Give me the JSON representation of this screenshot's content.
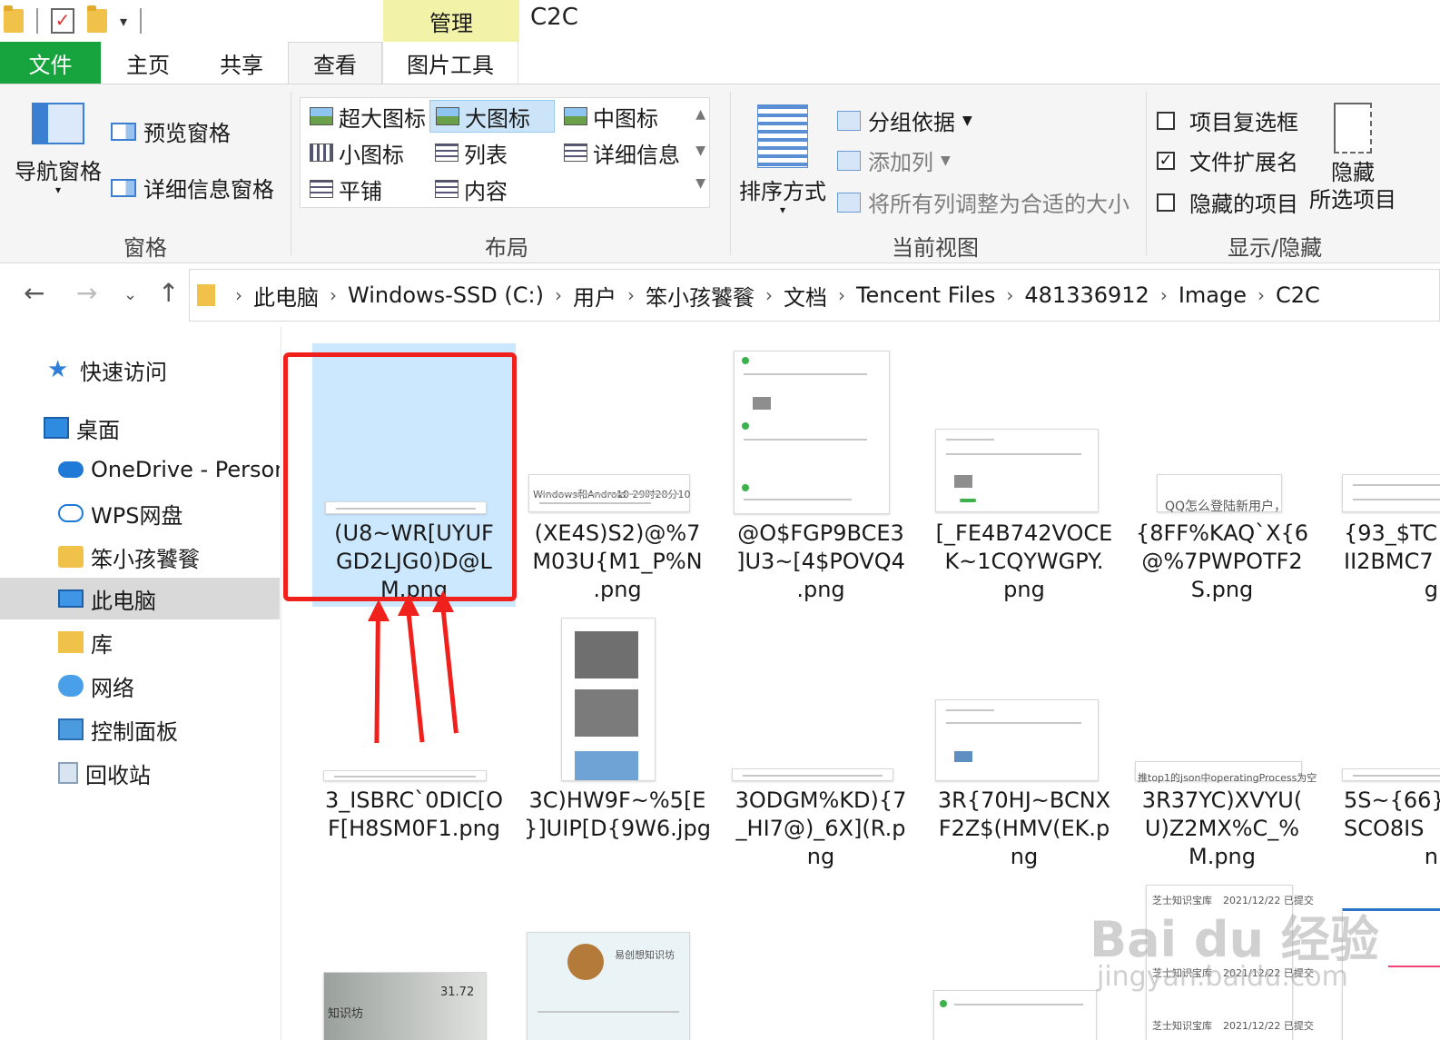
{
  "window": {
    "title": "C2C",
    "context_tab_header": "管理"
  },
  "tabs": [
    {
      "label": "文件"
    },
    {
      "label": "主页"
    },
    {
      "label": "共享"
    },
    {
      "label": "查看"
    },
    {
      "label": "图片工具"
    }
  ],
  "ribbon": {
    "panes": {
      "group_label": "窗格",
      "nav_pane": "导航窗格",
      "preview_pane": "预览窗格",
      "details_pane": "详细信息窗格"
    },
    "layout": {
      "group_label": "布局",
      "items": [
        "超大图标",
        "大图标",
        "中图标",
        "小图标",
        "列表",
        "详细信息",
        "平铺",
        "内容"
      ],
      "selected": "大图标"
    },
    "current_view": {
      "group_label": "当前视图",
      "sort_by": "排序方式",
      "group_by": "分组依据",
      "add_column": "添加列",
      "fit_columns": "将所有列调整为合适的大小"
    },
    "show_hide": {
      "group_label": "显示/隐藏",
      "item_checkboxes": {
        "label": "项目复选框",
        "checked": false
      },
      "file_extensions": {
        "label": "文件扩展名",
        "checked": true
      },
      "hidden_items": {
        "label": "隐藏的项目",
        "checked": false
      },
      "hide_selected_line1": "隐藏",
      "hide_selected_line2": "所选项目"
    }
  },
  "address": {
    "crumbs": [
      "此电脑",
      "Windows-SSD (C:)",
      "用户",
      "笨小孩饕餮",
      "文档",
      "Tencent Files",
      "481336912",
      "Image",
      "C2C"
    ]
  },
  "sidebar": {
    "items": [
      "快速访问",
      "桌面",
      "OneDrive - Person",
      "WPS网盘",
      "笨小孩饕餮",
      "此电脑",
      "库",
      "网络",
      "控制面板",
      "回收站"
    ],
    "selected": "此电脑"
  },
  "files": [
    {
      "name": "(U8~WR[UYUF GD2LJG0)D@L M.png",
      "l1": "(U8~WR[UYUF",
      "l2": "GD2LJG0)D@L",
      "l3": "M.png"
    },
    {
      "name": "(XE4S)S2)@%7 M03U{M1_P%N .png",
      "l1": "(XE4S)S2)@%7",
      "l2": "M03U{M1_P%N",
      "l3": ".png"
    },
    {
      "name": "@O$FGP9BCE3 ]U3~[4$POVQ4 .png",
      "l1": "@O$FGP9BCE3",
      "l2": "]U3~[4$POVQ4",
      "l3": ".png"
    },
    {
      "name": "[_FE4B742VOCE K~1CQYWGPY. png",
      "l1": "[_FE4B742VOCE",
      "l2": "K~1CQYWGPY.",
      "l3": "png"
    },
    {
      "name": "{8FF%KAQ`X{6 @%7PWPOTF2 S.png",
      "l1": "{8FF%KAQ`X{6",
      "l2": "@%7PWPOTF2",
      "l3": "S.png"
    },
    {
      "name": "{93_$TC II2BMC7",
      "l1": "{93_$TC",
      "l2": "II2BMC7",
      "l3": "g"
    },
    {
      "name": "3_ISBRC`0DIC[O F[H8SM0F1.png",
      "l1": "3_ISBRC`0DIC[O",
      "l2": "F[H8SM0F1.png",
      "l3": ""
    },
    {
      "name": "3C)HW9F~%5[E }]UIP[D{9W6.jpg",
      "l1": "3C)HW9F~%5[E",
      "l2": "}]UIP[D{9W6.jpg",
      "l3": ""
    },
    {
      "name": "3ODGM%KD){7 _HI7@)_6X](R.p ng",
      "l1": "3ODGM%KD){7",
      "l2": "_HI7@)_6X](R.p",
      "l3": "ng"
    },
    {
      "name": "3R{70HJ~BCNX F2Z$(HMV(EK.p ng",
      "l1": "3R{70HJ~BCNX",
      "l2": "F2Z$(HMV(EK.p",
      "l3": "ng"
    },
    {
      "name": "3R37YC)XVYU( U)Z2MX%C_% M.png",
      "l1": "3R37YC)XVYU(",
      "l2": "U)Z2MX%C_%",
      "l3": "M.png"
    },
    {
      "name": "5S~{66} SCO8IS",
      "l1": "5S~{66}",
      "l2": "SCO8IS",
      "l3": "n"
    }
  ],
  "thumb_texts": {
    "qq_login": "QQ怎么登陆新用户，",
    "json_null": "推top1的json中operatingProcess为空",
    "knowledge_shop": "易创想知识坊",
    "knowledge": "知识坊",
    "score": "31.72",
    "zhishi_baoku": "芝士知识宝库",
    "date_submitted": "2021/12/22  已提交",
    "windows_android": "Windows和Android",
    "date_line": "10 29时28分10"
  },
  "watermark": {
    "line1": "Bai du 经验",
    "line2": "jingyan.baidu.com"
  },
  "colors": {
    "file_tab": "#17a33e",
    "context_header": "#f2f3a8",
    "selection": "#cce8ff",
    "annotation": "#f0201c"
  }
}
